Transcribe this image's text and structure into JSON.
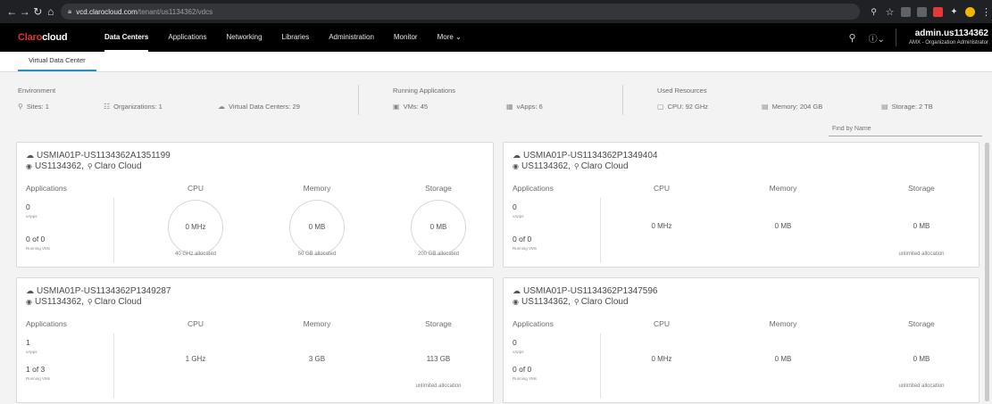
{
  "browser": {
    "url_host": "vcd.clarocloud.com",
    "url_path": "/tenant/us1134362/vdcs"
  },
  "header": {
    "logo_brand": "Claro",
    "logo_suffix": "cloud",
    "nav": [
      "Data Centers",
      "Applications",
      "Networking",
      "Libraries",
      "Administration",
      "Monitor",
      "More"
    ],
    "user_name": "admin.us1134362",
    "user_role": "AMX - Organization Administrator"
  },
  "subtab": "Virtual Data Center",
  "summary": {
    "environment_title": "Environment",
    "sites": "Sites: 1",
    "organizations": "Organizations: 1",
    "vdcs": "Virtual Data Centers: 29",
    "running_title": "Running Applications",
    "vms": "VMs: 45",
    "vapps": "vApps: 6",
    "used_title": "Used Resources",
    "cpu": "CPU: 92 GHz",
    "memory": "Memory: 204 GB",
    "storage": "Storage: 2 TB"
  },
  "find_placeholder": "Find by Name",
  "columns": {
    "applications": "Applications",
    "cpu": "CPU",
    "memory": "Memory",
    "storage": "Storage",
    "vapps_label": "vApps",
    "running_label": "Running VMs"
  },
  "cards": [
    {
      "name": "USMIA01P-US1134362A1351199",
      "org": "US1134362,",
      "site": "Claro Cloud",
      "vapps": "0",
      "running": "0 of 0",
      "cpu": "0 MHz",
      "memory": "0 MB",
      "storage": "0 MB",
      "cpu_alloc": "40 GHz allocated",
      "memory_alloc": "50 GB allocated",
      "storage_alloc": "200 GB allocated"
    },
    {
      "name": "USMIA01P-US1134362P1349404",
      "org": "US1134362,",
      "site": "Claro Cloud",
      "vapps": "0",
      "running": "0 of 0",
      "cpu": "0 MHz",
      "memory": "0 MB",
      "storage": "0 MB",
      "storage_alloc": "unlimited allocation"
    },
    {
      "name": "USMIA01P-US1134362P1349287",
      "org": "US1134362,",
      "site": "Claro Cloud",
      "vapps": "1",
      "running": "1 of 3",
      "cpu": "1 GHz",
      "memory": "3 GB",
      "storage": "113 GB",
      "storage_alloc": "unlimited allocation"
    },
    {
      "name": "USMIA01P-US1134362P1347596",
      "org": "US1134362,",
      "site": "Claro Cloud",
      "vapps": "0",
      "running": "0 of 0",
      "cpu": "0 MHz",
      "memory": "0 MB",
      "storage": "0 MB",
      "storage_alloc": "unlimited allocation"
    }
  ]
}
